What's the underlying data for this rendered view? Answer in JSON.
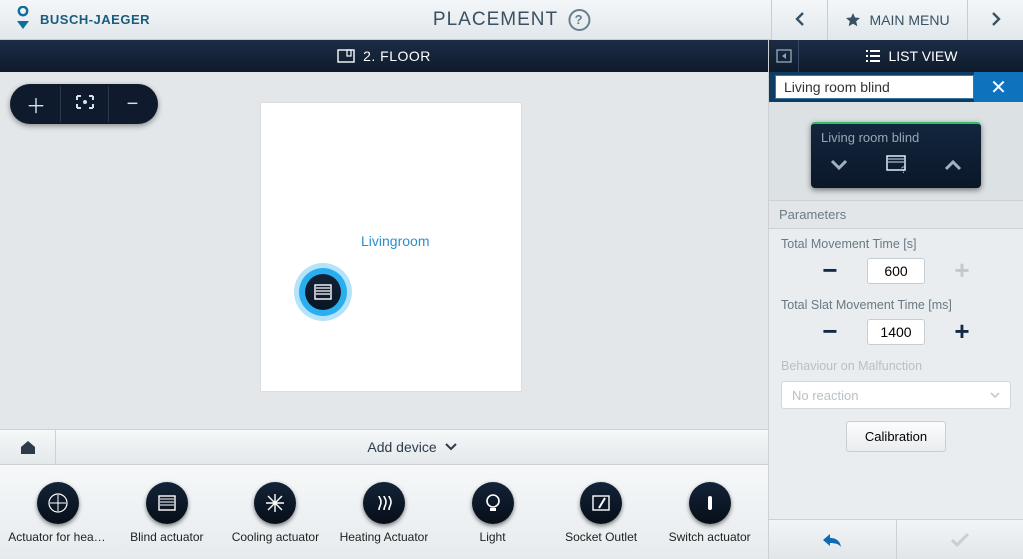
{
  "header": {
    "brand": "BUSCH-JAEGER",
    "title": "PLACEMENT",
    "main_menu": "MAIN MENU"
  },
  "floor": {
    "label": "2. FLOOR"
  },
  "room": {
    "name": "Livingroom"
  },
  "toolbar": {
    "add_device": "Add device"
  },
  "palette": [
    {
      "label": "Actuator for heati…",
      "icon": "heat-cool"
    },
    {
      "label": "Blind actuator",
      "icon": "blind"
    },
    {
      "label": "Cooling actuator",
      "icon": "snow"
    },
    {
      "label": "Heating Actuator",
      "icon": "heat"
    },
    {
      "label": "Light",
      "icon": "bulb"
    },
    {
      "label": "Socket Outlet",
      "icon": "socket"
    },
    {
      "label": "Switch actuator",
      "icon": "switch"
    }
  ],
  "right": {
    "list_view": "LIST VIEW",
    "search_value": "Living room blind",
    "device_name": "Living room blind",
    "parameters_header": "Parameters",
    "param1": {
      "label": "Total Movement Time [s]",
      "value": "600"
    },
    "param2": {
      "label": "Total Slat Movement Time [ms]",
      "value": "1400"
    },
    "param3": {
      "label": "Behaviour on Malfunction",
      "value": "No reaction"
    },
    "calibration": "Calibration"
  }
}
